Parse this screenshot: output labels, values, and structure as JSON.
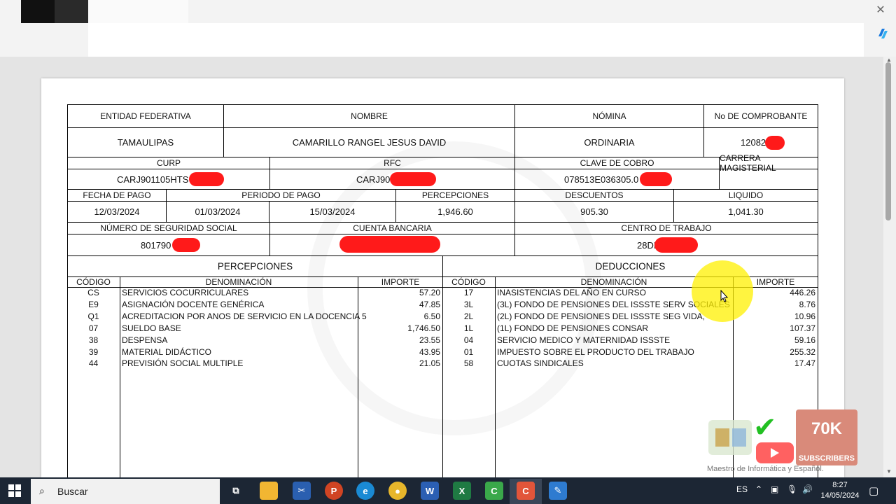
{
  "browser": {
    "close_label": "✕"
  },
  "document": {
    "row1_headers": [
      "ENTIDAD FEDERATIVA",
      "NOMBRE",
      "NÓMINA",
      "No DE COMPROBANTE"
    ],
    "row1_values": [
      "TAMAULIPAS",
      "CAMARILLO RANGEL JESUS DAVID",
      "ORDINARIA",
      "12082"
    ],
    "row2_headers": [
      "CURP",
      "RFC",
      "CLAVE DE COBRO",
      "CARRERA MAGISTERIAL"
    ],
    "row2_values": [
      "CARJ901105HTS",
      "CARJ90",
      "078513E036305.0",
      ""
    ],
    "row3_headers": [
      "FECHA DE PAGO",
      "PERIODO DE PAGO",
      "PERCEPCIONES",
      "DESCUENTOS",
      "LIQUIDO"
    ],
    "row3_values": [
      "12/03/2024",
      "01/03/2024",
      "15/03/2024",
      "1,946.60",
      "905.30",
      "1,041.30"
    ],
    "row4_headers": [
      "NÚMERO DE SEGURIDAD SOCIAL",
      "CUENTA BANCARIA",
      "CENTRO DE TRABAJO"
    ],
    "row4_values": [
      "801790",
      "",
      "28DF"
    ],
    "percepciones": {
      "title": "PERCEPCIONES",
      "col_codigo": "CÓDIGO",
      "col_denominacion": "DENOMINACIÓN",
      "col_importe": "IMPORTE",
      "rows": [
        {
          "codigo": "CS",
          "denominacion": "SERVICIOS COCURRICULARES",
          "importe": "57.20"
        },
        {
          "codigo": "E9",
          "denominacion": "ASIGNACIÓN DOCENTE GENÉRICA",
          "importe": "47.85"
        },
        {
          "codigo": "Q1",
          "denominacion": "ACREDITACION POR ANOS DE SERVICIO EN LA DOCENCIA 5",
          "importe": "6.50"
        },
        {
          "codigo": "07",
          "denominacion": "SUELDO BASE",
          "importe": "1,746.50"
        },
        {
          "codigo": "38",
          "denominacion": "DESPENSA",
          "importe": "23.55"
        },
        {
          "codigo": "39",
          "denominacion": "MATERIAL DIDÁCTICO",
          "importe": "43.95"
        },
        {
          "codigo": "44",
          "denominacion": "PREVISIÓN SOCIAL MULTIPLE",
          "importe": "21.05"
        }
      ]
    },
    "deducciones": {
      "title": "DEDUCCIONES",
      "col_codigo": "CÓDIGO",
      "col_denominacion": "DENOMINACIÓN",
      "col_importe": "IMPORTE",
      "rows": [
        {
          "codigo": "17",
          "denominacion": "INASISTENCIAS DEL AÑO EN CURSO",
          "importe": "446.26"
        },
        {
          "codigo": "3L",
          "denominacion": "(3L) FONDO DE PENSIONES DEL ISSSTE SERV SOCIALES",
          "importe": "8.76"
        },
        {
          "codigo": "2L",
          "denominacion": "(2L) FONDO DE PENSIONES DEL ISSSTE SEG VIDA,",
          "importe": "10.96"
        },
        {
          "codigo": "1L",
          "denominacion": "(1L) FONDO DE PENSIONES CONSAR",
          "importe": "107.37"
        },
        {
          "codigo": "04",
          "denominacion": "SERVICIO MEDICO Y MATERNIDAD ISSSTE",
          "importe": "59.16"
        },
        {
          "codigo": "01",
          "denominacion": "IMPUESTO SOBRE EL PRODUCTO DEL TRABAJO",
          "importe": "255.32"
        },
        {
          "codigo": "58",
          "denominacion": "CUOTAS SINDICALES",
          "importe": "17.47"
        }
      ]
    }
  },
  "overlay": {
    "subscribers_count": "70K",
    "subscribers_label": "SUBSCRIBERS",
    "channel_name": "Maestro de Informática y Español."
  },
  "taskbar": {
    "search_label": "Buscar",
    "language": "ES",
    "time": "8:27",
    "date": "14/05/2024",
    "apps": [
      "task-view",
      "file-explorer",
      "snipping-tool",
      "powerpoint",
      "edge",
      "chrome",
      "word",
      "excel",
      "camtasia-green",
      "camtasia",
      "paint"
    ]
  },
  "colors": {
    "redaction": "#ff1a1a",
    "taskbar": "#1c2634",
    "highlight": "#fff000"
  }
}
